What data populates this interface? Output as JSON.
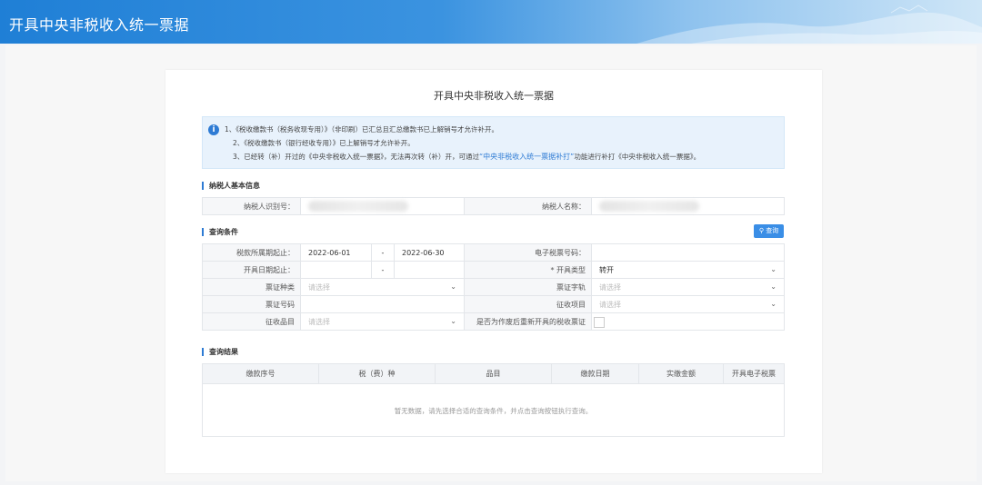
{
  "header": {
    "app_title": "开具中央非税收入统一票据"
  },
  "main": {
    "title": "开具中央非税收入统一票据",
    "notice": {
      "line1": "1、《税收缴款书（税务收现专用）》（非印刷）已汇总且汇总缴款书已上解销号才允许补开。",
      "line2": "2、《税收缴款书（银行经收专用）》已上解销号才允许补开。",
      "line3_prefix": "3、已经转（补）开过的《中央非税收入统一票据》，无法再次转（补）开，可通过",
      "line3_link": "“中央非税收入统一票据补打”",
      "line3_suffix": "功能进行补打《中央非税收入统一票据》。"
    },
    "taxpayer_section": {
      "heading": "纳税人基本信息",
      "id_label": "纳税人识别号：",
      "name_label": "纳税人名称："
    },
    "query_section": {
      "heading": "查询条件",
      "query_button": "查询",
      "period_label": "税款所属期起止：",
      "period_start": "2022-06-01",
      "period_sep": "-",
      "period_end": "2022-06-30",
      "e_ticket_label": "电子税票号码：",
      "issue_date_label": "开具日期起止：",
      "issue_date_sep": "-",
      "issue_type_label": "* 开具类型",
      "issue_type_value": "转开",
      "voucher_type_label": "票证种类",
      "voucher_type_placeholder": "请选择",
      "voucher_word_label": "票证字轨",
      "voucher_word_placeholder": "请选择",
      "voucher_no_label": "票证号码",
      "levy_item_label": "征收项目",
      "levy_item_placeholder": "请选择",
      "levy_subitem_label": "征收品目",
      "levy_subitem_placeholder": "请选择",
      "reissue_label": "是否为作废后重新开具的税收票证"
    },
    "result_section": {
      "heading": "查询结果",
      "columns": [
        "缴款序号",
        "税（费）种",
        "品目",
        "缴款日期",
        "实缴金额",
        "开具电子税票"
      ],
      "empty_text": "暂无数据，请先选择合适的查询条件，并点击查询按钮执行查询。"
    }
  },
  "colors": {
    "accent": "#2e7bd4",
    "header_blue": "#1f7fd6"
  },
  "icons": {
    "notice": "info-icon",
    "query": "search-icon",
    "dropdown": "chevron-down-icon"
  }
}
